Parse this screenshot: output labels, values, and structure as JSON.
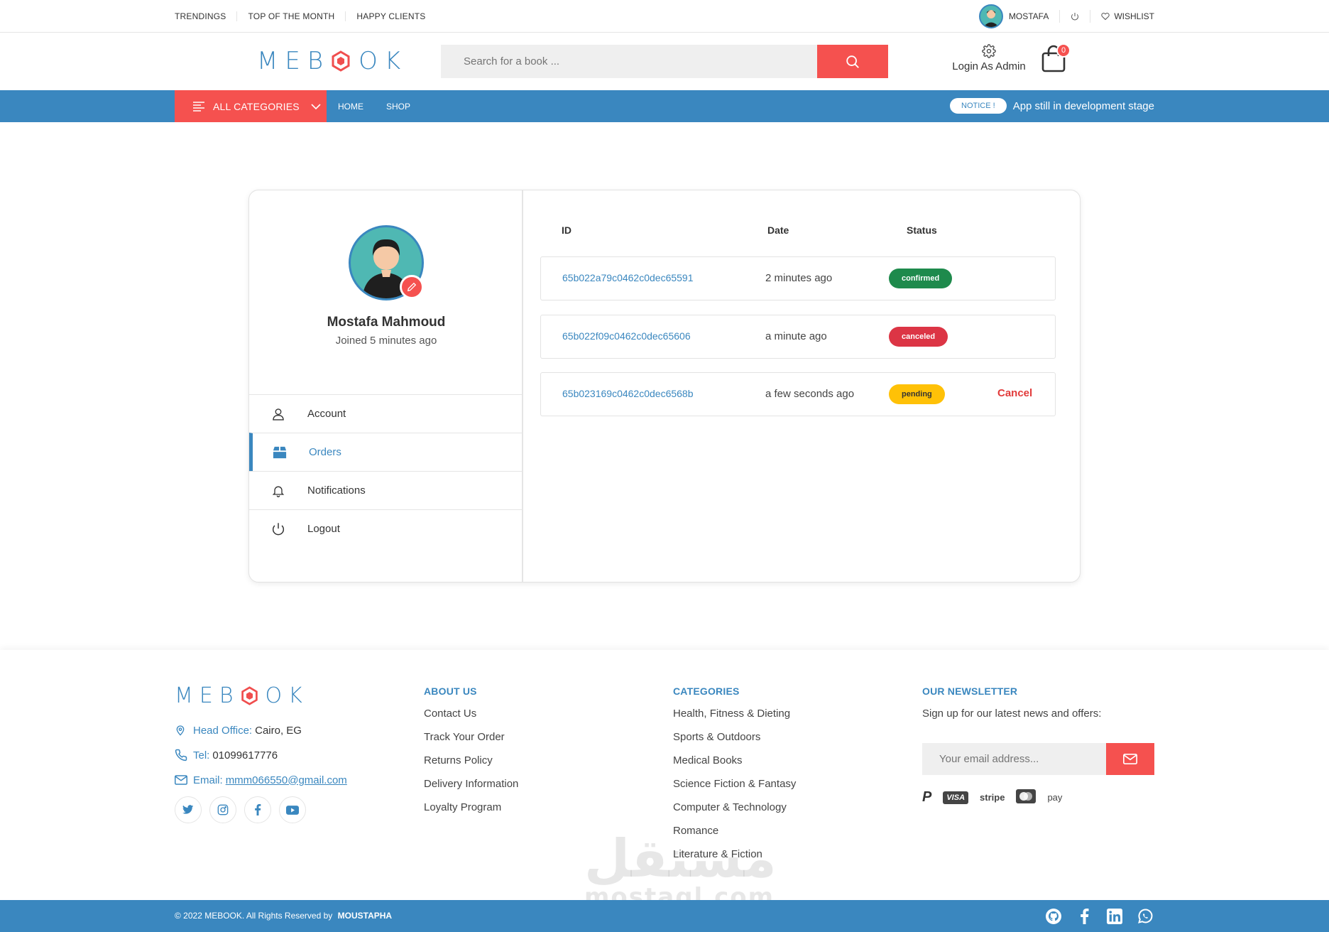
{
  "topbar": {
    "links": [
      "TRENDINGS",
      "TOP OF THE MONTH",
      "HAPPY CLIENTS"
    ],
    "username": "MOSTAFA",
    "wishlist": "WISHLIST"
  },
  "header": {
    "logo": {
      "left": "M",
      "mid1": "E",
      "mid2": "B",
      "right": "OK"
    },
    "search_placeholder": "Search for a book ...",
    "admin_label": "Login As Admin",
    "cart_count": "0"
  },
  "nav": {
    "all_categories": "ALL CATEGORIES",
    "links": [
      "HOME",
      "SHOP"
    ],
    "notice_pill": "NOTICE !",
    "notice_text": "App still in development stage"
  },
  "profile": {
    "name": "Mostafa Mahmoud",
    "joined": "Joined 5 minutes ago",
    "menu": [
      {
        "label": "Account",
        "icon": "user-icon",
        "active": false
      },
      {
        "label": "Orders",
        "icon": "box-icon",
        "active": true
      },
      {
        "label": "Notifications",
        "icon": "bell-icon",
        "active": false
      },
      {
        "label": "Logout",
        "icon": "power-icon",
        "active": false
      }
    ]
  },
  "orders": {
    "headers": {
      "id": "ID",
      "date": "Date",
      "status": "Status"
    },
    "rows": [
      {
        "id": "65b022a79c0462c0dec65591",
        "date": "2 minutes ago",
        "status": "confirmed",
        "status_color": "#1e8a4c",
        "action": ""
      },
      {
        "id": "65b022f09c0462c0dec65606",
        "date": "a minute ago",
        "status": "canceled",
        "status_color": "#dc3545",
        "action": ""
      },
      {
        "id": "65b023169c0462c0dec6568b",
        "date": "a few seconds ago",
        "status": "pending",
        "status_color": "#ffc107",
        "action": "Cancel"
      }
    ]
  },
  "footer": {
    "head_office_label": "Head Office:",
    "head_office_value": "Cairo, EG",
    "tel_label": "Tel:",
    "tel_value": "01099617776",
    "email_label": "Email:",
    "email_value": "mmm066550@gmail.com",
    "social_icons": [
      "twitter-icon",
      "instagram-icon",
      "facebook-icon",
      "youtube-icon"
    ],
    "about": {
      "title": "ABOUT US",
      "items": [
        "Contact Us",
        "Track Your Order",
        "Returns Policy",
        "Delivery Information",
        "Loyalty Program"
      ]
    },
    "categories": {
      "title": "CATEGORIES",
      "items": [
        "Health, Fitness & Dieting",
        "Sports & Outdoors",
        "Medical Books",
        "Science Fiction & Fantasy",
        "Computer & Technology",
        "Romance",
        "Literature & Fiction"
      ]
    },
    "newsletter": {
      "title": "OUR NEWSLETTER",
      "text": "Sign up for our latest news and offers:",
      "placeholder": "Your email address...",
      "payments": [
        "P",
        "VISA",
        "stripe",
        "mastercard",
        "pay"
      ]
    },
    "copyright": "© 2022 MEBOOK. All Rights Reserved by",
    "author": "MOUSTAPHA",
    "bottom_icons": [
      "github-icon",
      "facebook-icon",
      "linkedin-icon",
      "whatsapp-icon"
    ]
  },
  "watermark": {
    "arabic": "مستقل",
    "latin": "mostaql.com"
  },
  "colors": {
    "primary": "#3a87bf",
    "accent": "#f5514f"
  }
}
